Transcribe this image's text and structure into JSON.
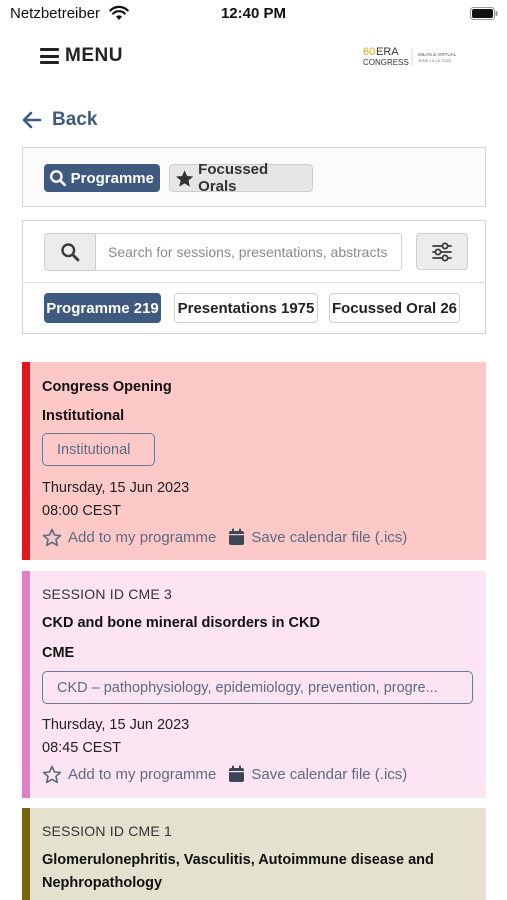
{
  "status_bar": {
    "carrier": "Netzbetreiber",
    "time": "12:40 PM",
    "wifi_icon": "wifi-icon",
    "battery_icon": "battery-icon"
  },
  "header": {
    "menu_label": "MENU",
    "menu_icon": "hamburger-icon",
    "logo": {
      "number": "60",
      "brand": "ERA",
      "subtitle": "CONGRESS",
      "location_line1": "MILAN & VIRTUAL",
      "location_line2": "JUNE 15-18, 2023"
    }
  },
  "back": {
    "label": "Back",
    "icon": "arrow-left-icon"
  },
  "tabs": [
    {
      "label": "Programme",
      "icon": "search-icon",
      "active": true
    },
    {
      "label": "Focussed Orals",
      "icon": "star-icon",
      "active": false
    }
  ],
  "search": {
    "placeholder": "Search for sessions, presentations, abstracts",
    "value": "",
    "search_icon": "search-icon",
    "filter_icon": "sliders-icon"
  },
  "counts": [
    {
      "label": "Programme 219",
      "active": true
    },
    {
      "label": "Presentations 1975",
      "active": false
    },
    {
      "label": "Focussed Oral 26",
      "active": false
    }
  ],
  "sessions": [
    {
      "id_label": "",
      "title": "Congress Opening",
      "category": "Institutional",
      "tag": "Institutional",
      "date": "Thursday, 15 Jun 2023",
      "time": "08:00 CEST",
      "add_label": "Add to my programme",
      "calendar_label": "Save calendar file (.ics)",
      "accent": "#e1171b",
      "background": "#fdc9c8"
    },
    {
      "id_label": "SESSION ID CME 3",
      "title": "CKD and bone mineral disorders in CKD",
      "category": "CME",
      "tag": "CKD – pathophysiology, epidemiology, prevention, progre...",
      "date": "Thursday, 15 Jun 2023",
      "time": "08:45 CEST",
      "add_label": "Add to my programme",
      "calendar_label": "Save calendar file (.ics)",
      "accent": "#e07fc9",
      "background": "#fde4f3"
    },
    {
      "id_label": "SESSION ID CME 1",
      "title": "Glomerulonephritis, Vasculitis, Autoimmune disease and Nephropathology",
      "accent": "#7b6510",
      "background": "#e5e1cf"
    }
  ],
  "colors": {
    "primary": "#3f5a7e",
    "action_text": "#5b6b82"
  }
}
